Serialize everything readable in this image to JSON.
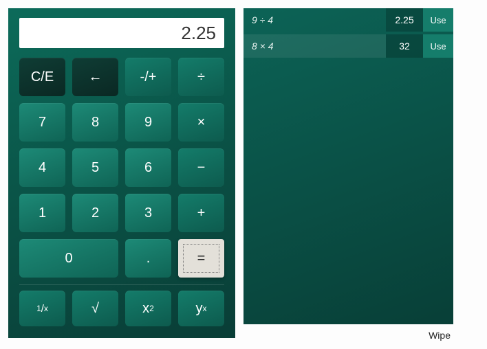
{
  "display": "2.25",
  "keys": {
    "clear": "C/E",
    "back": "←",
    "sign": "-/+",
    "divide": "÷",
    "k7": "7",
    "k8": "8",
    "k9": "9",
    "multiply": "×",
    "k4": "4",
    "k5": "5",
    "k6": "6",
    "minus": "−",
    "k1": "1",
    "k2": "2",
    "k3": "3",
    "plus": "+",
    "k0": "0",
    "decimal": ".",
    "equals": "="
  },
  "funcs": {
    "inverse_num": "1",
    "inverse_den": "x",
    "sqrt": "√",
    "square_base": "x",
    "square_exp": "2",
    "power_base": "y",
    "power_exp": "x"
  },
  "history": [
    {
      "expr": "9 ÷ 4",
      "result": "2.25",
      "use": "Use"
    },
    {
      "expr": "8 × 4",
      "result": "32",
      "use": "Use"
    }
  ],
  "wipe": "Wipe",
  "colors": {
    "accent": "#0e7a67",
    "dark": "#0a2823",
    "equals": "#e3e0d9"
  }
}
